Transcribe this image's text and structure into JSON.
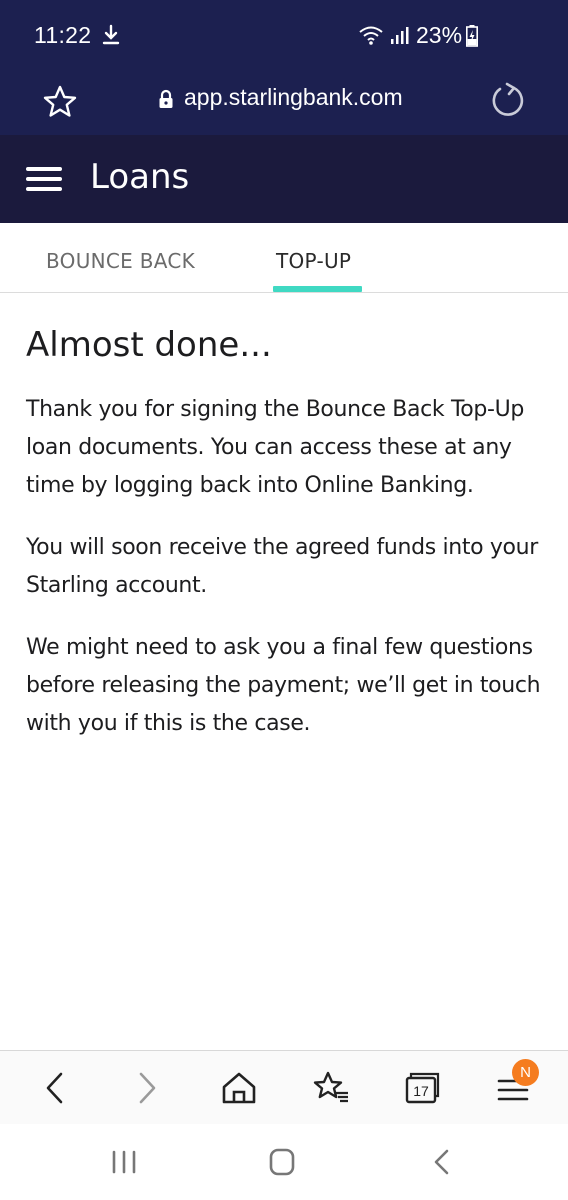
{
  "status_bar": {
    "time": "11:22",
    "battery": "23%",
    "icons": [
      "download-icon",
      "wifi-icon",
      "signal-icon",
      "battery-charging-icon"
    ]
  },
  "browser": {
    "url": "app.starlingbank.com",
    "icons": [
      "star-icon",
      "lock-icon",
      "reload-icon"
    ]
  },
  "header": {
    "title": "Loans",
    "icons": [
      "hamburger-menu-icon"
    ]
  },
  "tabs": [
    {
      "label": "BOUNCE BACK",
      "active": false
    },
    {
      "label": "TOP-UP",
      "active": true
    }
  ],
  "content": {
    "heading": "Almost done...",
    "paragraphs": [
      "Thank you for signing the Bounce Back Top-Up loan documents. You can access these at any time by logging back into Online Banking.",
      "You will soon receive the agreed funds into your Starling account.",
      "We might need to ask you a final few questions before releasing the payment; we’ll get in touch with you if this is the case."
    ]
  },
  "toolbar": {
    "tabs_count": "17",
    "menu_badge": "N",
    "icons": [
      "back-icon",
      "forward-icon",
      "home-icon",
      "bookmarks-icon",
      "tabs-icon",
      "menu-icon"
    ]
  },
  "colors": {
    "status_bg": "#1c2050",
    "header_bg": "#1b1a3d",
    "tab_accent": "#40d9c3",
    "badge": "#f57c1f"
  }
}
